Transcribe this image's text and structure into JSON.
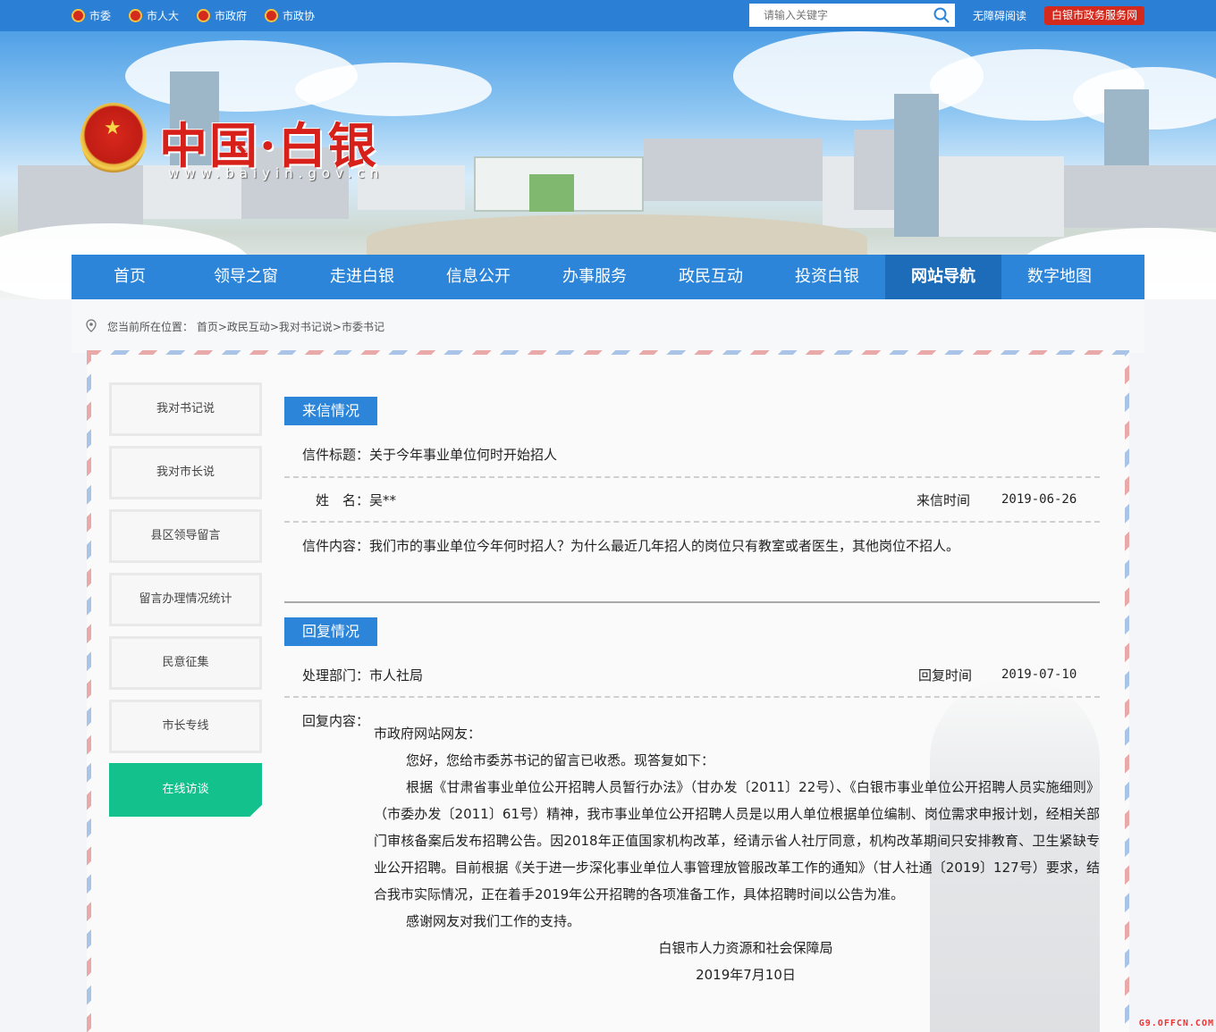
{
  "topbar": {
    "links": [
      {
        "label": "市委"
      },
      {
        "label": "市人大"
      },
      {
        "label": "市政府"
      },
      {
        "label": "市政协"
      }
    ],
    "search_placeholder": "请输入关键字",
    "accessibility_label": "无障碍阅读",
    "service_label": "白银市政务服务网"
  },
  "banner": {
    "title": "中国·白银",
    "url": "www.baiyin.gov.cn"
  },
  "nav": {
    "items": [
      {
        "label": "首页"
      },
      {
        "label": "领导之窗"
      },
      {
        "label": "走进白银"
      },
      {
        "label": "信息公开"
      },
      {
        "label": "办事服务"
      },
      {
        "label": "政民互动"
      },
      {
        "label": "投资白银"
      },
      {
        "label": "网站导航",
        "active": true
      },
      {
        "label": "数字地图"
      }
    ]
  },
  "breadcrumb": {
    "text": "您当前所在位置：  首页>政民互动>我对书记说>市委书记"
  },
  "sidebar": {
    "items": [
      {
        "label": "我对书记说"
      },
      {
        "label": "我对市长说"
      },
      {
        "label": "县区领导留言"
      },
      {
        "label": "留言办理情况统计"
      },
      {
        "label": "民意征集"
      },
      {
        "label": "市长专线"
      },
      {
        "label": "在线访谈",
        "active": true
      }
    ]
  },
  "letter": {
    "section_title": "来信情况",
    "subject_label": "信件标题：",
    "subject": "关于今年事业单位何时开始招人",
    "name_label": "姓　名：",
    "name": "吴**",
    "time_label": "来信时间",
    "time": "2019-06-26",
    "content_label": "信件内容：",
    "content": "我们市的事业单位今年何时招人？为什么最近几年招人的岗位只有教室或者医生，其他岗位不招人。"
  },
  "reply": {
    "section_title": "回复情况",
    "dept_label": "处理部门：",
    "dept": "市人社局",
    "time_label": "回复时间",
    "time": "2019-07-10",
    "content_label": "回复内容：",
    "greeting": "市政府网站网友：",
    "p1": "您好，您给市委苏书记的留言已收悉。现答复如下：",
    "p2": "根据《甘肃省事业单位公开招聘人员暂行办法》（甘办发〔2011〕22号）、《白银市事业单位公开招聘人员实施细则》（市委办发〔2011〕61号）精神，我市事业单位公开招聘人员是以用人单位根据单位编制、岗位需求申报计划，经相关部门审核备案后发布招聘公告。因2018年正值国家机构改革，经请示省人社厅同意，机构改革期间只安排教育、卫生紧缺专业公开招聘。目前根据《关于进一步深化事业单位人事管理放管服改革工作的通知》（甘人社通〔2019〕127号）要求，结合我市实际情况，正在着手2019年公开招聘的各项准备工作，具体招聘时间以公告为准。",
    "p3": "感谢网友对我们工作的支持。",
    "signature": "白银市人力资源和社会保障局",
    "date": "2019年7月10日"
  },
  "watermark": "G9.OFFCN.COM"
}
